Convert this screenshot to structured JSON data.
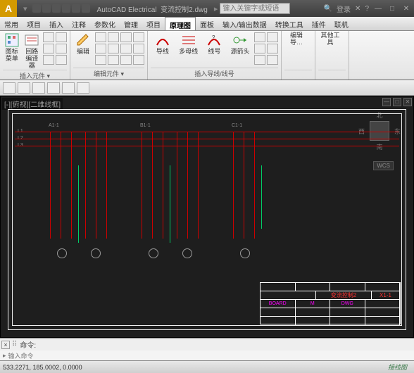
{
  "titlebar": {
    "logo": "A",
    "app": "AutoCAD Electrical",
    "doc": "变流控制2.dwg",
    "search_placeholder": "键入关键字或短语",
    "login": "登录",
    "help": "?"
  },
  "tabs": [
    "常用",
    "项目",
    "插入",
    "注释",
    "参数化",
    "管理",
    "项目",
    "原理图",
    "面板",
    "输入/输出数据",
    "转换工具",
    "插件",
    "联机"
  ],
  "tabs_active_index": 7,
  "ribbon": {
    "panels": [
      {
        "label": "插入元件 ▾",
        "big": [
          {
            "lbl": "图标菜单"
          },
          {
            "lbl": "回路编译器"
          }
        ]
      },
      {
        "label": "编辑元件 ▾",
        "big": [
          {
            "lbl": "编辑"
          }
        ]
      },
      {
        "label": "插入导线/线号",
        "big": [
          {
            "lbl": "导线"
          },
          {
            "lbl": "多母线"
          },
          {
            "lbl": "线号"
          },
          {
            "lbl": "源箭头"
          }
        ]
      },
      {
        "label": "",
        "big": [
          {
            "lbl": "编辑导…"
          }
        ]
      },
      {
        "label": "",
        "big": [
          {
            "lbl": "其他工具"
          }
        ]
      }
    ]
  },
  "viewport": {
    "label": "[-][俯视][二维线框]",
    "nav": {
      "n": "北",
      "s": "南",
      "e": "东",
      "w": "西"
    },
    "wcs": "WCS"
  },
  "bus_labels": [
    "L1",
    "L2",
    "L3"
  ],
  "branch_labels": [
    "A1-1",
    "B1-1",
    "C1-1"
  ],
  "titleblock": {
    "title": "变流控制2",
    "sheet": "X1-1",
    "cells": [
      "BOARD",
      "M",
      "DWG"
    ]
  },
  "cmd": {
    "prompt": "命令:",
    "echo": "输入命令"
  },
  "status": {
    "coords": "533.2271, 185.0002, 0.0000",
    "watermark": "接线图"
  }
}
